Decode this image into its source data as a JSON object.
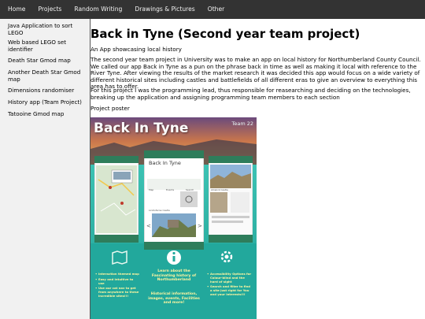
{
  "nav": {
    "items": [
      {
        "label": "Home"
      },
      {
        "label": "Projects"
      },
      {
        "label": "Random Writing"
      },
      {
        "label": "Drawings & Pictures"
      },
      {
        "label": "Other"
      }
    ]
  },
  "sidebar": {
    "items": [
      {
        "label": "Java Application to sort LEGO"
      },
      {
        "label": "Web based LEGO set identifier"
      },
      {
        "label": "Death Star Gmod map"
      },
      {
        "label": "Another Death Star Gmod map"
      },
      {
        "label": "Dimensions randomiser"
      },
      {
        "label": "History app (Team Project)"
      },
      {
        "label": "Tatooine Gmod map"
      }
    ]
  },
  "main": {
    "title": "Back in Tyne (Second year team project)",
    "subtitle": "An App showcasing local history",
    "paragraph1": "The second year team project in University was to make an app on local history for Northumberland County Council. We called our app Back in Tyne as a pun on the phrase back in time as well as making it local with reference to the River Tyne. After viewing the results of the market research it was decided this app would focus on a wide variety of different historical sites including castles and battlefields of all different eras to give an overview to everything this area has to offer.",
    "paragraph2": "For this project I was the programming lead, thus responsible for reasearching and deciding on the technologies, breaking up the application and assigning programming team members to each section",
    "poster_label": "Project poster"
  },
  "poster": {
    "title": "Back In Tyne",
    "team": "Team 22",
    "center_phone": {
      "app_title": "Back In Tyne",
      "tabs": [
        "Map",
        "Events",
        "Search"
      ],
      "castle_label": "Lindisfarne Castle"
    },
    "right_phone": {
      "castle_label": "Alnwick Castle"
    },
    "features": {
      "left": [
        "Interaction themed map",
        "Easy and intuitive to use",
        "Use our cat nav to get from anywhere to these incredible sites!!!"
      ],
      "center_head": "Learn about the Fascinating history of Northumberland",
      "center_sub": "Historical information, images, events, Facilities and more!",
      "right": [
        "Accessibility Options for Colour-blind and the hard of sight",
        "Search and filter to find a site just right for You and your interests!!!"
      ]
    }
  },
  "colors": {
    "nav_bg": "#333333",
    "sidebar_bg": "#f1f1f1",
    "poster_teal": "#27b3a6",
    "app_green": "#2e7d5b",
    "feature_text": "#fff6a0"
  }
}
